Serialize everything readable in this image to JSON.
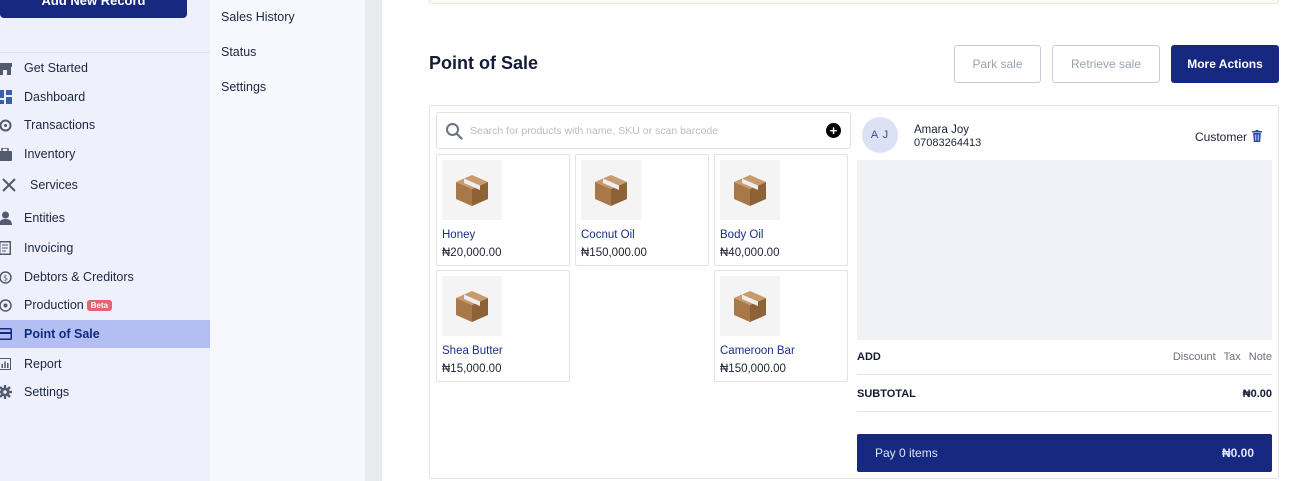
{
  "sidebar": {
    "add_record_label": "Add New Record",
    "items": [
      {
        "label": "Get Started",
        "icon": "store-icon"
      },
      {
        "label": "Dashboard",
        "icon": "dashboard-icon"
      },
      {
        "label": "Transactions",
        "icon": "transactions-icon"
      },
      {
        "label": "Inventory",
        "icon": "briefcase-icon"
      },
      {
        "label": "Services",
        "icon": "tools-icon"
      },
      {
        "label": "Entities",
        "icon": "person-icon"
      },
      {
        "label": "Invoicing",
        "icon": "invoice-icon"
      },
      {
        "label": "Debtors & Creditors",
        "icon": "debtors-icon"
      },
      {
        "label": "Production",
        "icon": "production-icon",
        "badge": "Beta"
      },
      {
        "label": "Point of Sale",
        "icon": "card-icon",
        "active": true
      },
      {
        "label": "Report",
        "icon": "report-icon"
      },
      {
        "label": "Settings",
        "icon": "gear-icon"
      }
    ]
  },
  "submenu": {
    "items": [
      "Sales History",
      "Status",
      "Settings"
    ]
  },
  "header": {
    "title": "Point of Sale",
    "park_sale": "Park sale",
    "retrieve_sale": "Retrieve sale",
    "more_actions": "More Actions"
  },
  "search": {
    "placeholder": "Search for products with name, SKU or scan barcode",
    "value": ""
  },
  "products": [
    {
      "name": "Honey",
      "price": "₦20,000.00"
    },
    {
      "name": "Cocnut Oil",
      "price": "₦150,000.00"
    },
    {
      "name": "Body Oil",
      "price": "₦40,000.00"
    },
    {
      "name": "Shea Butter",
      "price": "₦15,000.00"
    },
    {
      "name": "Cameroon Bar",
      "price": "₦150,000.00"
    }
  ],
  "customer": {
    "initials": "A J",
    "name": "Amara Joy",
    "phone": "07083264413",
    "label": "Customer"
  },
  "cart": {
    "add_label": "ADD",
    "discount": "Discount",
    "tax": "Tax",
    "note": "Note",
    "subtotal_label": "SUBTOTAL",
    "subtotal_value": "₦0.00",
    "pay_label": "Pay 0 items",
    "pay_amount": "₦0.00"
  },
  "colors": {
    "primary": "#16287f",
    "active_nav": "#b3bff2",
    "badge": "#e4626f"
  }
}
